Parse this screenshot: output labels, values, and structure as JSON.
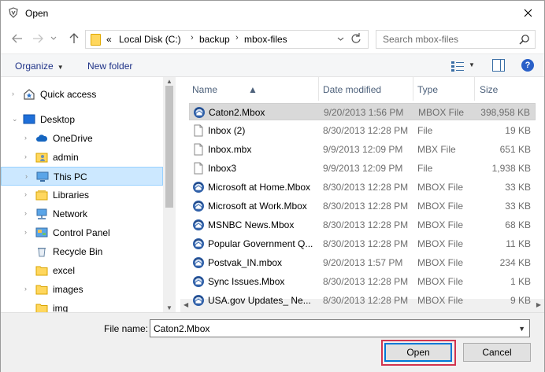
{
  "window": {
    "title": "Open"
  },
  "address": {
    "overflow": "«",
    "segments": [
      "Local Disk (C:)",
      "backup",
      "mbox-files"
    ],
    "separator": "›"
  },
  "search": {
    "placeholder": "Search mbox-files"
  },
  "toolbar": {
    "organize": "Organize",
    "new_folder": "New folder"
  },
  "nav": {
    "items": [
      {
        "label": "Quick access",
        "icon": "star-icon",
        "indent": 0,
        "chevron": "›"
      },
      {
        "label": "Desktop",
        "icon": "desktop-icon",
        "indent": 0,
        "chevron": "⌄"
      },
      {
        "label": "OneDrive",
        "icon": "cloud-icon",
        "indent": 1,
        "chevron": "›"
      },
      {
        "label": "admin",
        "icon": "user-folder-icon",
        "indent": 1,
        "chevron": "›"
      },
      {
        "label": "This PC",
        "icon": "computer-icon",
        "indent": 1,
        "chevron": "›",
        "selected": true
      },
      {
        "label": "Libraries",
        "icon": "library-icon",
        "indent": 1,
        "chevron": "›"
      },
      {
        "label": "Network",
        "icon": "network-icon",
        "indent": 1,
        "chevron": "›"
      },
      {
        "label": "Control Panel",
        "icon": "control-panel-icon",
        "indent": 1,
        "chevron": "›"
      },
      {
        "label": "Recycle Bin",
        "icon": "recycle-bin-icon",
        "indent": 1,
        "chevron": ""
      },
      {
        "label": "excel",
        "icon": "folder-icon",
        "indent": 1,
        "chevron": ""
      },
      {
        "label": "images",
        "icon": "folder-icon",
        "indent": 1,
        "chevron": "›"
      },
      {
        "label": "img",
        "icon": "folder-icon",
        "indent": 1,
        "chevron": ""
      }
    ]
  },
  "columns": {
    "name": "Name",
    "date": "Date modified",
    "type": "Type",
    "size": "Size"
  },
  "files": [
    {
      "name": "Caton2.Mbox",
      "date": "9/20/2013 1:56 PM",
      "type": "MBOX File",
      "size": "398,958 KB",
      "icon": "thunderbird",
      "selected": true
    },
    {
      "name": "Inbox (2)",
      "date": "8/30/2013 12:28 PM",
      "type": "File",
      "size": "19 KB",
      "icon": "doc"
    },
    {
      "name": "Inbox.mbx",
      "date": "9/9/2013 12:09 PM",
      "type": "MBX File",
      "size": "651 KB",
      "icon": "doc"
    },
    {
      "name": "Inbox3",
      "date": "9/9/2013 12:09 PM",
      "type": "File",
      "size": "1,938 KB",
      "icon": "doc"
    },
    {
      "name": "Microsoft at Home.Mbox",
      "date": "8/30/2013 12:28 PM",
      "type": "MBOX File",
      "size": "33 KB",
      "icon": "thunderbird"
    },
    {
      "name": "Microsoft at Work.Mbox",
      "date": "8/30/2013 12:28 PM",
      "type": "MBOX File",
      "size": "33 KB",
      "icon": "thunderbird"
    },
    {
      "name": "MSNBC News.Mbox",
      "date": "8/30/2013 12:28 PM",
      "type": "MBOX File",
      "size": "68 KB",
      "icon": "thunderbird"
    },
    {
      "name": "Popular Government Q...",
      "date": "8/30/2013 12:28 PM",
      "type": "MBOX File",
      "size": "11 KB",
      "icon": "thunderbird"
    },
    {
      "name": "Postvak_IN.mbox",
      "date": "9/20/2013 1:57 PM",
      "type": "MBOX File",
      "size": "234 KB",
      "icon": "thunderbird"
    },
    {
      "name": "Sync Issues.Mbox",
      "date": "8/30/2013 12:28 PM",
      "type": "MBOX File",
      "size": "1 KB",
      "icon": "thunderbird"
    },
    {
      "name": "USA.gov Updates_ Ne...",
      "date": "8/30/2013 12:28 PM",
      "type": "MBOX File",
      "size": "9 KB",
      "icon": "thunderbird"
    }
  ],
  "bottom": {
    "filename_label": "File name:",
    "filename_value": "Caton2.Mbox",
    "open_label": "Open",
    "cancel_label": "Cancel"
  },
  "colors": {
    "accent": "#0078d7",
    "selection": "#cce8ff",
    "highlight": "#d1344f",
    "folder": "#ffd75e"
  }
}
